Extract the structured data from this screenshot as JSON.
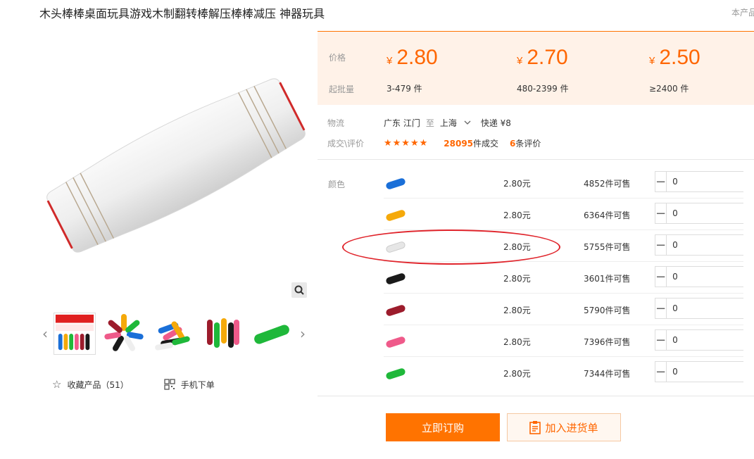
{
  "product": {
    "title": "木头棒棒桌面玩具游戏木制翻转棒解压棒棒减压 神器玩具",
    "corner_tag": "本产品"
  },
  "gallery": {
    "links": {
      "favorite": "收藏产品（51）",
      "mobile_order": "手机下单"
    }
  },
  "pricing": {
    "price_label": "价格",
    "moq_label": "起批量",
    "currency": "¥",
    "tiers": [
      {
        "price": "2.80",
        "range": "3-479 件"
      },
      {
        "price": "2.70",
        "range": "480-2399 件"
      },
      {
        "price": "2.50",
        "range": "≥2400 件"
      }
    ]
  },
  "logistics": {
    "label": "物流",
    "origin": "广东 江门",
    "to": "至",
    "destination": "上海",
    "shipping": "快递 ¥8"
  },
  "deals": {
    "label": "成交\\评价",
    "stars": "★★★★★",
    "deal_count": "28095",
    "deal_suffix": "件成交",
    "review_count": "6",
    "review_suffix": "条评价"
  },
  "sku": {
    "label": "颜色",
    "rows": [
      {
        "color": "#1a6fd8",
        "price": "2.80元",
        "stock": "4852件可售",
        "qty": "0"
      },
      {
        "color": "#f5a90a",
        "price": "2.80元",
        "stock": "6364件可售",
        "qty": "0"
      },
      {
        "color": "#e6e6e6",
        "price": "2.80元",
        "stock": "5755件可售",
        "qty": "0"
      },
      {
        "color": "#1a1a1a",
        "price": "2.80元",
        "stock": "3601件可售",
        "qty": "0"
      },
      {
        "color": "#9c1c2c",
        "price": "2.80元",
        "stock": "5790件可售",
        "qty": "0"
      },
      {
        "color": "#ef5a8a",
        "price": "2.80元",
        "stock": "7396件可售",
        "qty": "0"
      },
      {
        "color": "#1fb83a",
        "price": "2.80元",
        "stock": "7344件可售",
        "qty": "0"
      }
    ]
  },
  "actions": {
    "order": "立即订购",
    "add_to_list": "加入进货单"
  },
  "colors": {
    "accent": "#ff6600",
    "button_orange": "#ff7300",
    "annotation_red": "#e0242b"
  }
}
